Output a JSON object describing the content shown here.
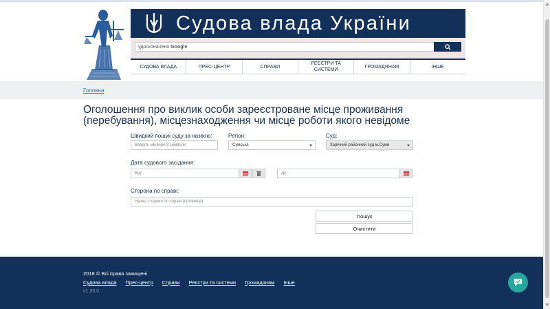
{
  "header": {
    "title": "Судова влада України",
    "search_placeholder": "удосконалено",
    "search_brand": "Google"
  },
  "nav": {
    "items": [
      "СУДОВА ВЛАДА",
      "ПРЕС-ЦЕНТР",
      "СПРАВИ",
      "РЕЄСТРИ ТА СИСТЕМИ",
      "ГРОМАДЯНАМ",
      "ІНШЕ"
    ]
  },
  "breadcrumb": {
    "home": "Головна"
  },
  "page": {
    "title": "Оголошення про виклик особи зареєстроване місце проживання (перебування), місцезнаходження чи місце роботи якого невідоме"
  },
  "form": {
    "court_search_label": "Швидкий пошук суду за назвою:",
    "court_search_placeholder": "Введіть мінімум 3 символи",
    "region_label": "Регіон:",
    "region_value": "Сумська",
    "court_label": "Суд:",
    "court_value": "Зарічний районний суд м.Суми",
    "date_label": "Дата судового засідання:",
    "date_from_placeholder": "Від:",
    "date_to_placeholder": "До:",
    "party_label": "Сторона по справі:",
    "party_placeholder": "Назва сторони по справі (прізвище)",
    "search_button": "Пошук",
    "clear_button": "Очистити"
  },
  "footer": {
    "copyright": "2018 © Всі права захищені",
    "links": [
      "Судова влада",
      "Прес-центр",
      "Справи",
      "Реєстри та системи",
      "Громадянам",
      "Інше"
    ],
    "version": "v1.33.0"
  },
  "colors": {
    "navy": "#13305a",
    "link": "#2c6fbf",
    "chat": "#24a8a0"
  },
  "icons": [
    "themis-emblem-icon",
    "trident-icon",
    "search-icon",
    "calendar-icon",
    "trash-icon",
    "chat-icon"
  ]
}
